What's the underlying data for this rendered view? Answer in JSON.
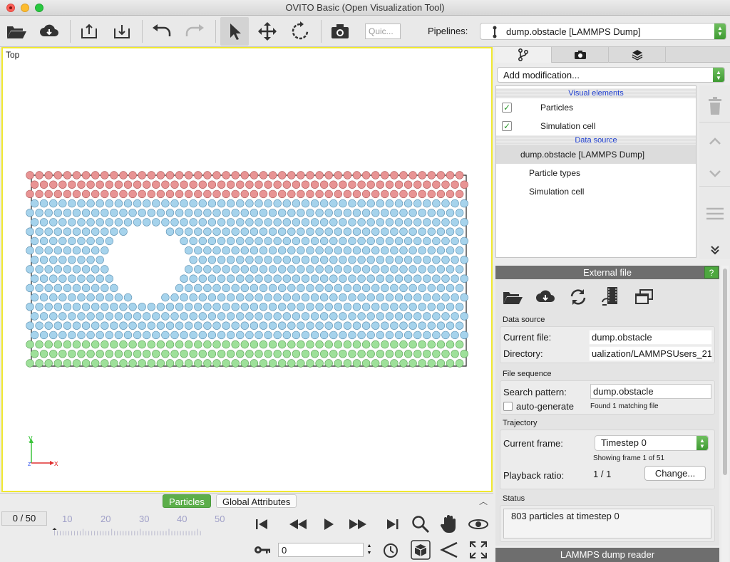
{
  "window": {
    "title": "OVITO Basic (Open Visualization Tool)"
  },
  "toolbar": {
    "quick_placeholder": "Quic...",
    "pipelines_label": "Pipelines:",
    "pipeline_selected": "dump.obstacle [LAMMPS Dump]",
    "buttons": [
      "open-folder-icon",
      "cloud-download-icon",
      "export-icon",
      "import-icon",
      "undo-icon",
      "redo-icon",
      "select-arrow-icon",
      "move-icon",
      "rotate-icon",
      "camera-icon"
    ]
  },
  "viewport": {
    "label": "Top",
    "axis_y": "y",
    "axis_x": "x",
    "axis_z": "z",
    "colors": {
      "top_layer": "#e89494",
      "bulk": "#a6d3ec",
      "bottom_layer": "#9ee09a",
      "border": "#f0e830"
    }
  },
  "inspector": {
    "tabs": [
      "Particles",
      "Global Attributes"
    ],
    "active": "Particles"
  },
  "animation": {
    "frame_display": "0 / 50",
    "tick_labels": [
      "10",
      "20",
      "30",
      "40",
      "50"
    ],
    "spinner_value": "0"
  },
  "right_panel": {
    "tabs": [
      "pipeline-icon",
      "render-icon",
      "layers-icon"
    ],
    "add_modification": "Add modification...",
    "visual_elements_header": "Visual elements",
    "visual_elements": [
      {
        "label": "Particles",
        "checked": true
      },
      {
        "label": "Simulation cell",
        "checked": true
      }
    ],
    "data_source_header": "Data source",
    "data_source": "dump.obstacle [LAMMPS Dump]",
    "data_source_children": [
      "Particle types",
      "Simulation cell"
    ]
  },
  "external_file": {
    "title": "External file",
    "help": "?",
    "data_source_title": "Data source",
    "current_file_label": "Current file:",
    "current_file": "dump.obstacle",
    "directory_label": "Directory:",
    "directory": "ualization/LAMMPSUsers_21",
    "file_sequence_title": "File sequence",
    "search_pattern_label": "Search pattern:",
    "search_pattern": "dump.obstacle",
    "auto_generate_label": "auto-generate",
    "found_text": "Found 1 matching file",
    "trajectory_title": "Trajectory",
    "current_frame_label": "Current frame:",
    "current_frame": "Timestep 0",
    "showing_frame": "Showing frame 1 of 51",
    "playback_ratio_label": "Playback ratio:",
    "playback_ratio": "1 / 1",
    "change_button": "Change...",
    "status_title": "Status",
    "status_text": "803 particles at timestep 0",
    "lammps_reader": "LAMMPS dump reader"
  }
}
